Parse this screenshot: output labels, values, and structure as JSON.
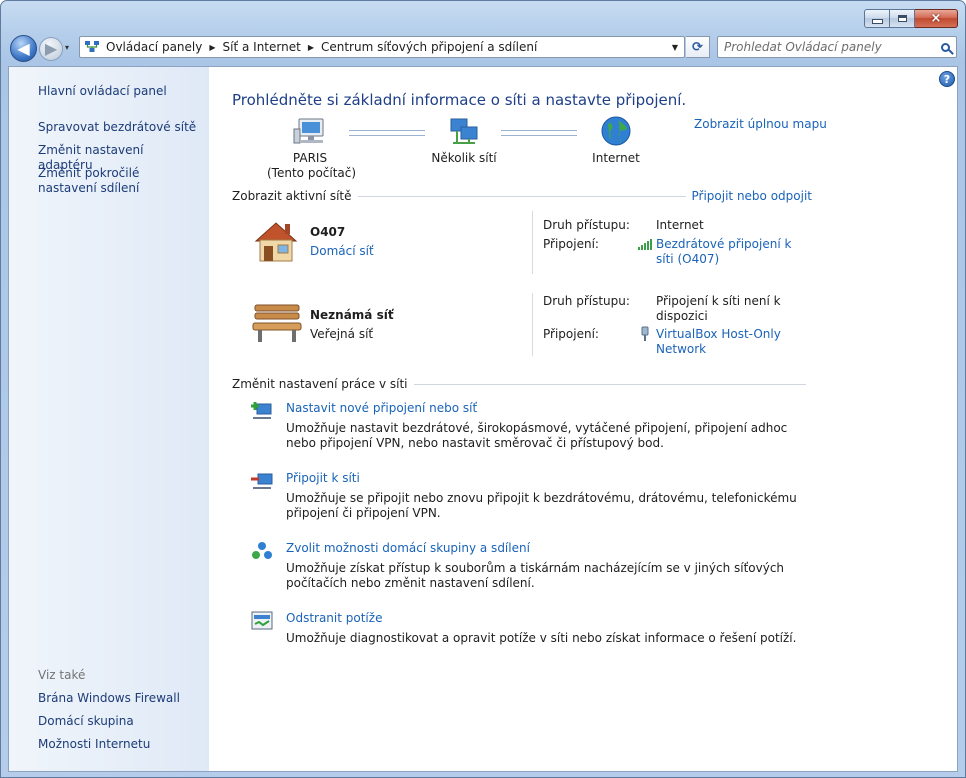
{
  "window": {
    "caption_buttons": {
      "minimize": "minimize",
      "maximize": "maximize",
      "close": "×"
    }
  },
  "navigation": {
    "back_glyph": "◀",
    "forward_glyph": "▶",
    "history_glyph": "▾",
    "breadcrumb": [
      "Ovládací panely",
      "Síť a Internet",
      "Centrum síťových připojení a sdílení"
    ],
    "separator": "▶",
    "dropdown_glyph": "▼",
    "refresh_glyph": "⟳",
    "search_placeholder": "Prohledat Ovládací panely"
  },
  "sidebar": {
    "items": [
      {
        "label": "Hlavní ovládací panel"
      },
      {
        "label": "Spravovat bezdrátové sítě"
      },
      {
        "label": "Změnit nastavení adaptéru"
      },
      {
        "label": "Změnit pokročilé nastavení sdílení"
      }
    ],
    "see_also_label": "Viz také",
    "see_also": [
      {
        "label": "Brána Windows Firewall"
      },
      {
        "label": "Domácí skupina"
      },
      {
        "label": "Možnosti Internetu"
      }
    ]
  },
  "help_glyph": "?",
  "main": {
    "title": "Prohlédněte si základní informace o síti a nastavte připojení.",
    "full_map_link": "Zobrazit úplnou mapu",
    "map_nodes": {
      "computer": {
        "name": "PARIS",
        "note": "(Tento počítač)"
      },
      "networks": {
        "name": "Několik sítí"
      },
      "internet": {
        "name": "Internet"
      }
    },
    "active_section": {
      "title": "Zobrazit aktivní sítě",
      "action": "Připojit nebo odpojit"
    },
    "networks": [
      {
        "name": "O407",
        "type": "Domácí síť",
        "access_label": "Druh přístupu:",
        "access_value": "Internet",
        "connection_label": "Připojení:",
        "connection_value": "Bezdrátové připojení k síti (O407)"
      },
      {
        "name": "Neznámá síť",
        "type": "Veřejná síť",
        "access_label": "Druh přístupu:",
        "access_value": "Připojení k síti není k dispozici",
        "connection_label": "Připojení:",
        "connection_value": "VirtualBox Host-Only Network"
      }
    ],
    "change_section": {
      "title": "Změnit nastavení práce v síti"
    },
    "tasks": [
      {
        "link": "Nastavit nové připojení nebo síť",
        "description": "Umožňuje nastavit bezdrátové, širokopásmové, vytáčené připojení, připojení adhoc nebo připojení VPN, nebo nastavit směrovač či přístupový bod."
      },
      {
        "link": "Připojit k síti",
        "description": "Umožňuje se připojit nebo znovu připojit k bezdrátovému, drátovému, telefonickému připojení či připojení VPN."
      },
      {
        "link": "Zvolit možnosti domácí skupiny a sdílení",
        "description": "Umožňuje získat přístup k souborům a tiskárnám nacházejícím se v jiných síťových počítačích nebo změnit nastavení sdílení."
      },
      {
        "link": "Odstranit potíže",
        "description": "Umožňuje diagnostikovat a opravit potíže v síti nebo získat informace o řešení potíží."
      }
    ]
  }
}
